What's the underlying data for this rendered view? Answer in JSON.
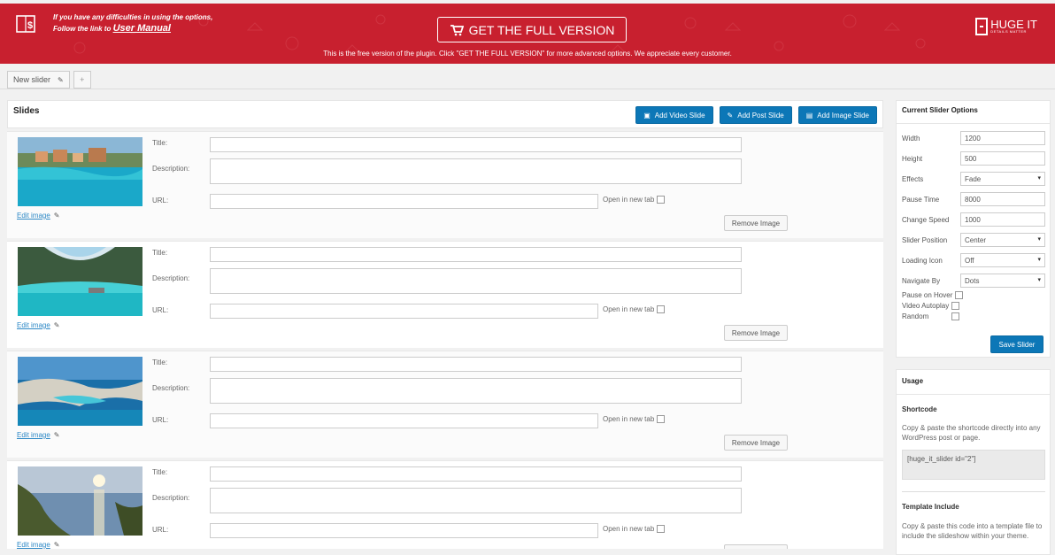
{
  "banner": {
    "help_line1": "If you have any difficulties in using the options,",
    "help_line2_prefix": "Follow the link to ",
    "help_link": "User Manual",
    "full_version_label": "GET THE FULL VERSION",
    "free_notice": "This is the free version of the plugin. Click \"GET THE FULL VERSION\" for more advanced options. We appreciate every customer.",
    "brand_name": "HUGE IT",
    "brand_tagline": "DETAILS MATTER"
  },
  "tabs": [
    {
      "label": "New slider"
    },
    {
      "label": "+"
    }
  ],
  "slides": {
    "title": "Slides",
    "add_video_label": "Add Video Slide",
    "add_post_label": "Add Post Slide",
    "add_image_label": "Add Image Slide",
    "field_title": "Title:",
    "field_description": "Description:",
    "field_url": "URL:",
    "open_new_tab": "Open in new tab",
    "edit_image": "Edit image",
    "remove_image": "Remove Image",
    "items": [
      {
        "title": "",
        "description": "",
        "url": ""
      },
      {
        "title": "",
        "description": "",
        "url": ""
      },
      {
        "title": "",
        "description": "",
        "url": ""
      },
      {
        "title": "",
        "description": "",
        "url": ""
      }
    ]
  },
  "options": {
    "title": "Current Slider Options",
    "width_label": "Width",
    "width_value": "1200",
    "height_label": "Height",
    "height_value": "500",
    "effects_label": "Effects",
    "effects_value": "Fade",
    "pause_label": "Pause Time",
    "pause_value": "8000",
    "speed_label": "Change Speed",
    "speed_value": "1000",
    "position_label": "Slider Position",
    "position_value": "Center",
    "loading_label": "Loading Icon",
    "loading_value": "Off",
    "navigate_label": "Navigate By",
    "navigate_value": "Dots",
    "pause_hover_label": "Pause on Hover",
    "video_autoplay_label": "Video Autoplay",
    "random_label": "Random",
    "save_label": "Save Slider"
  },
  "usage": {
    "title": "Usage",
    "shortcode_title": "Shortcode",
    "shortcode_text": "Copy & paste the shortcode directly into any WordPress post or page.",
    "shortcode_value": "[huge_it_slider id=\"2\"]",
    "template_title": "Template Include",
    "template_text": "Copy & paste this code into a template file to include the slideshow within your theme."
  },
  "colors": {
    "banner_red": "#c8202f",
    "button_blue": "#0c77b7",
    "link_blue": "#2e89c6"
  }
}
